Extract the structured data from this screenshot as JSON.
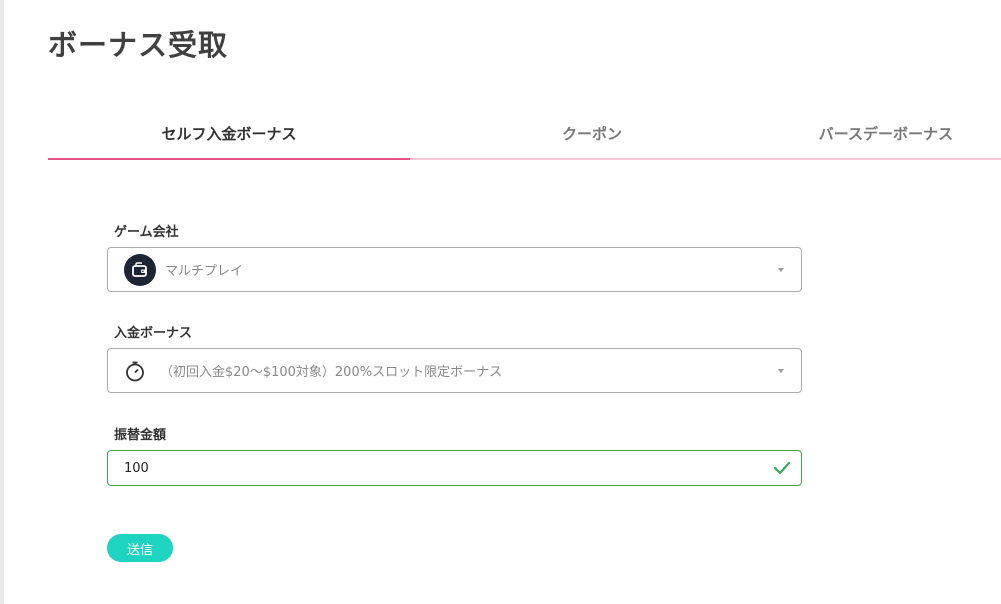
{
  "page": {
    "title": "ボーナス受取"
  },
  "tabs": [
    {
      "label": "セルフ入金ボーナス",
      "active": true
    },
    {
      "label": "クーポン",
      "active": false
    },
    {
      "label": "バースデーボーナス",
      "active": false
    }
  ],
  "form": {
    "provider": {
      "label": "ゲーム会社",
      "value": "マルチプレイ",
      "icon": "wallet-icon"
    },
    "bonus": {
      "label": "入金ボーナス",
      "value": "（初回入金$20～$100対象）200%スロット限定ボーナス",
      "icon": "stopwatch-icon"
    },
    "amount": {
      "label": "振替金額",
      "value": "100",
      "status_icon": "check-icon"
    },
    "submit_label": "送信"
  },
  "colors": {
    "accent_tab": "#e8548a",
    "tab_underline": "#f4c6d6",
    "valid_border": "#3aa856",
    "submit_bg": "#1ed3bf"
  }
}
